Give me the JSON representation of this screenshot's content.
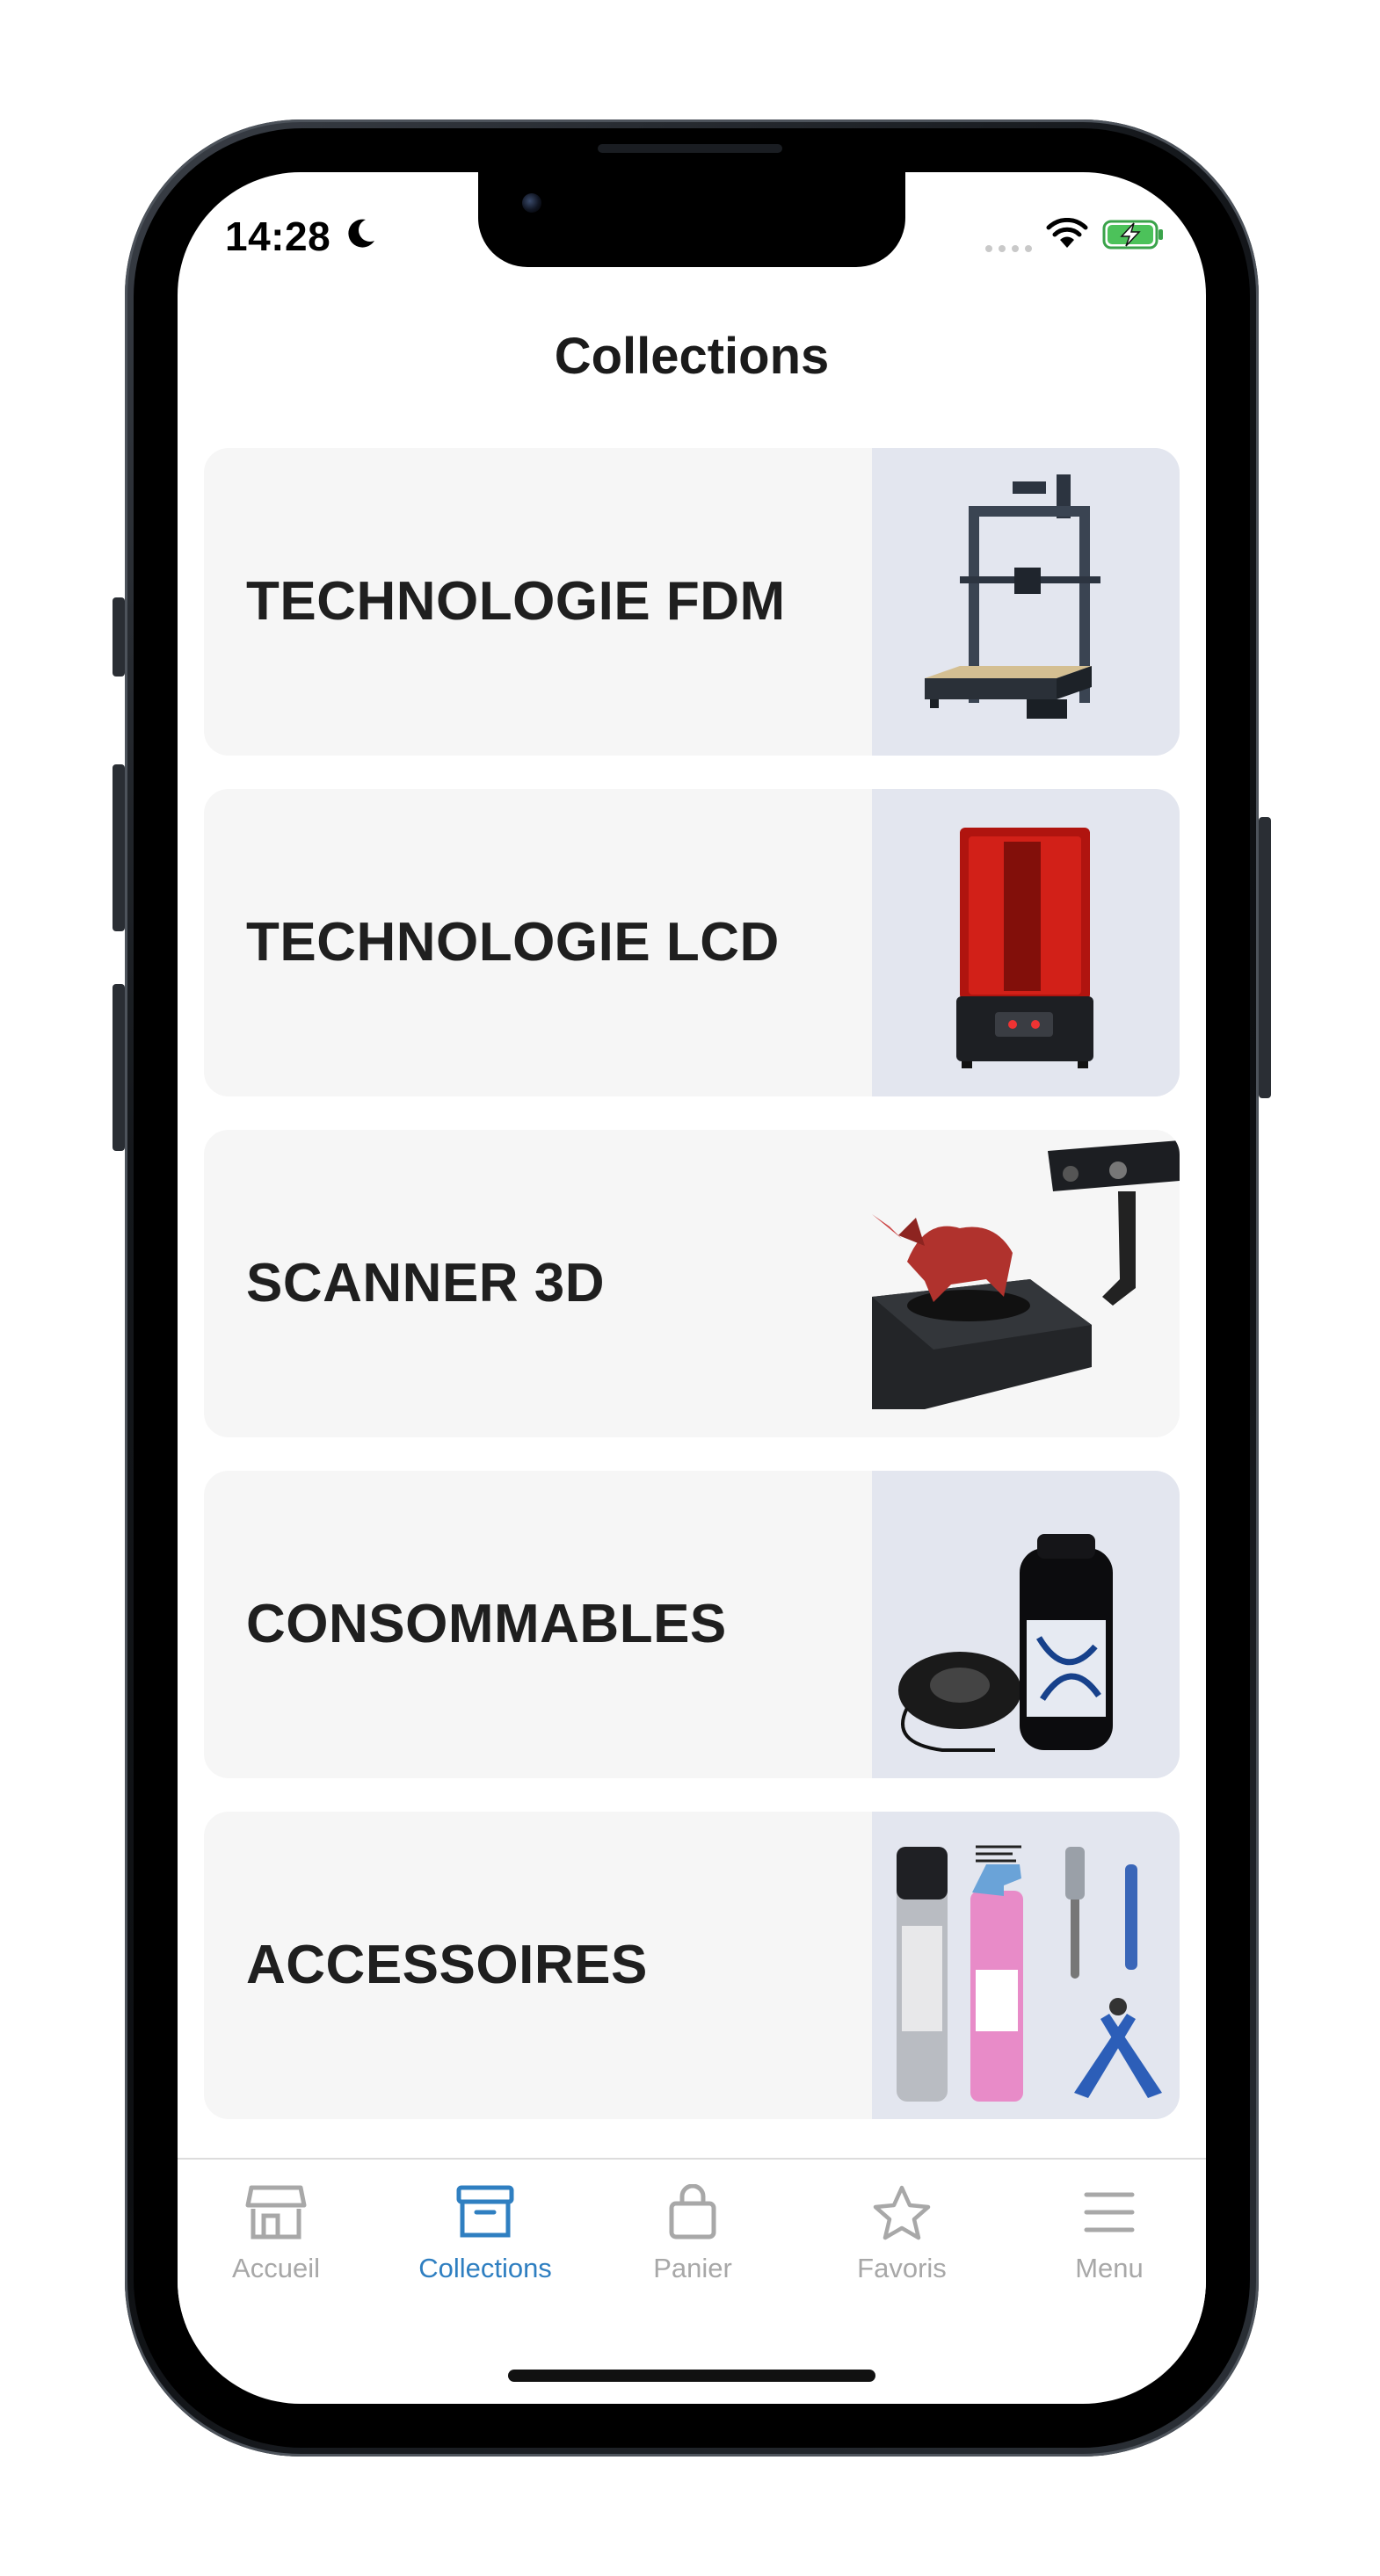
{
  "status_bar": {
    "time": "14:28"
  },
  "header": {
    "title": "Collections"
  },
  "collections": [
    {
      "label": "TECHNOLOGIE FDM",
      "image": "fdm-printer"
    },
    {
      "label": "TECHNOLOGIE LCD",
      "image": "resin-printer"
    },
    {
      "label": "SCANNER 3D",
      "image": "3d-scanner"
    },
    {
      "label": "CONSOMMABLES",
      "image": "filament-and-resin"
    },
    {
      "label": "ACCESSOIRES",
      "image": "tools-and-sprays"
    }
  ],
  "tabbar": {
    "tabs": [
      {
        "label": "Accueil",
        "icon": "storefront-icon"
      },
      {
        "label": "Collections",
        "icon": "archive-box-icon",
        "active": true
      },
      {
        "label": "Panier",
        "icon": "shopping-bag-icon"
      },
      {
        "label": "Favoris",
        "icon": "star-icon"
      },
      {
        "label": "Menu",
        "icon": "hamburger-menu-icon"
      }
    ]
  },
  "colors": {
    "accent": "#2f7fc1",
    "inactive": "#a8a8a8",
    "card_bg": "#f6f6f6",
    "image_bg": "#e3e6ef"
  }
}
